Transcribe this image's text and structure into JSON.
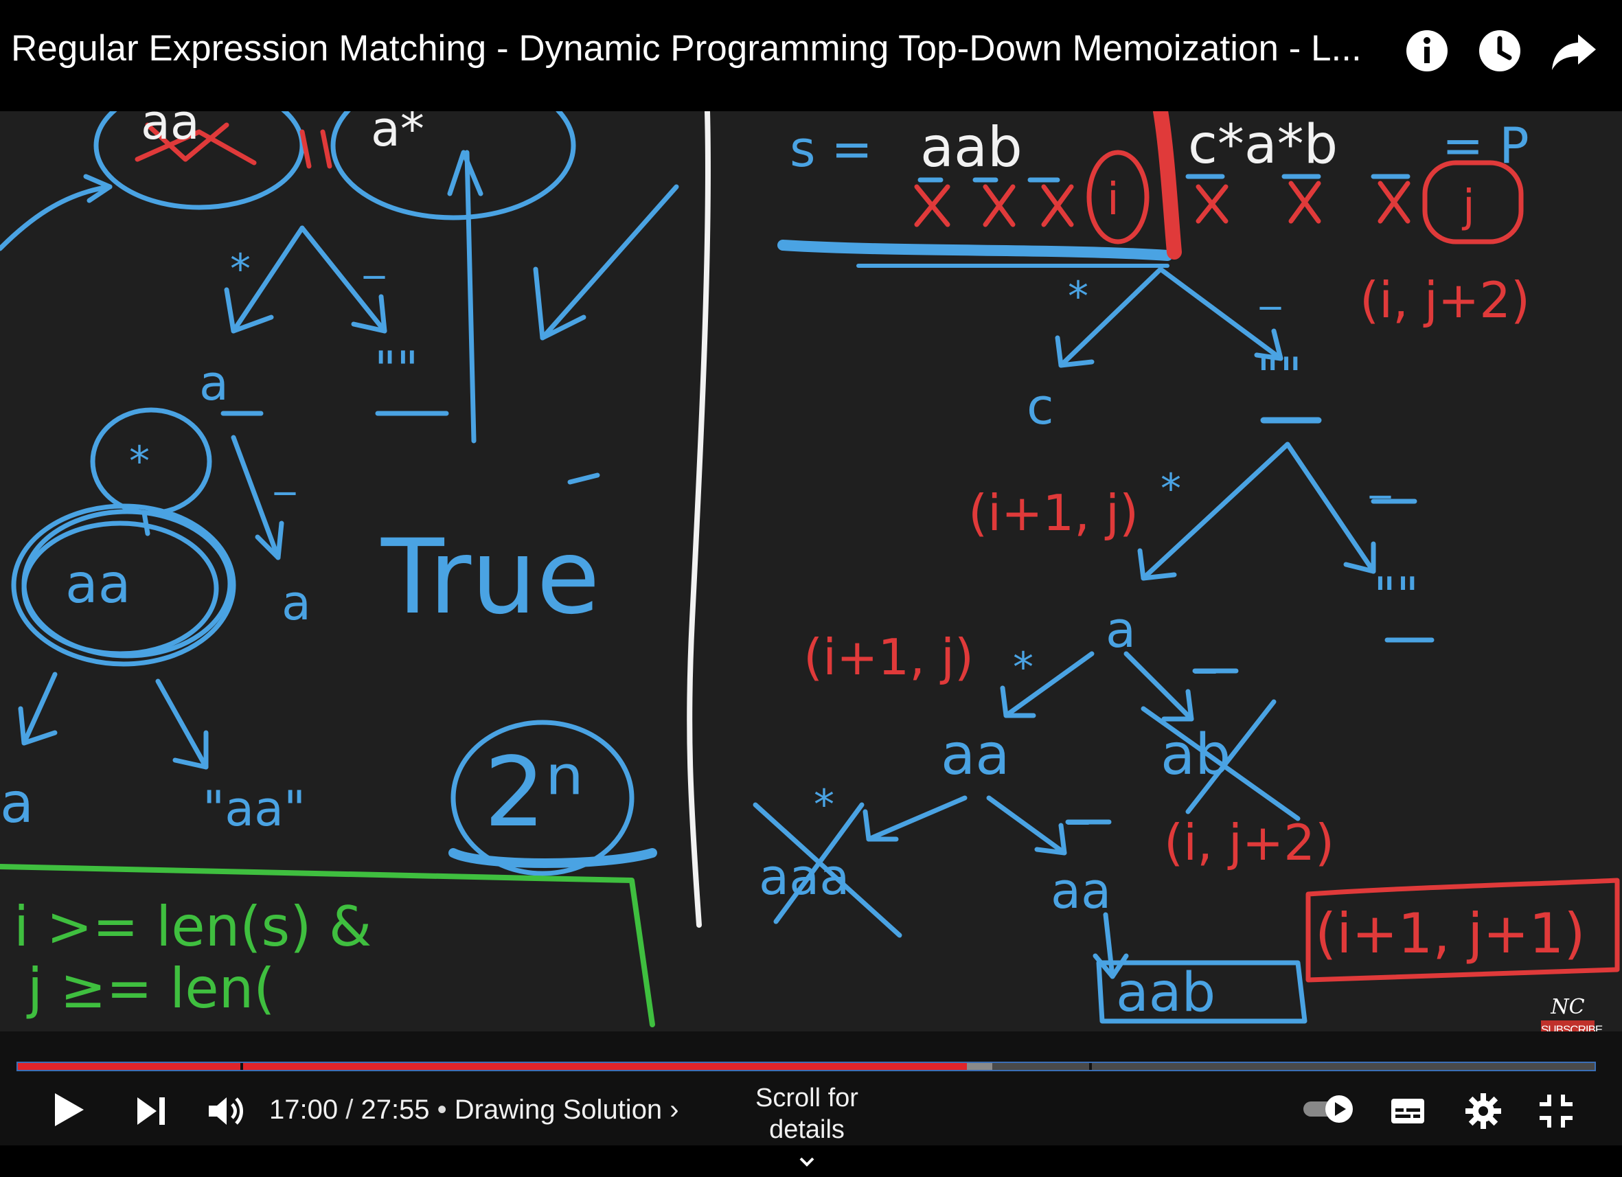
{
  "header": {
    "title": "Regular Expression Matching - Dynamic Programming Top-Down Memoization - L...",
    "icons": [
      "info-icon",
      "watch-later-icon",
      "share-icon"
    ]
  },
  "board": {
    "left": {
      "top_tokens": [
        "aa",
        "a*"
      ],
      "branch_star": "*",
      "branch_underscore": "_",
      "node_a": "a",
      "node_empty": "\"\"",
      "node_aa": "aa",
      "node_a2": "a",
      "node_a3": "a",
      "node_aa_quoted": "\"aa\"",
      "true_label": "True",
      "complexity": "2ⁿ",
      "base_case_line1": "i >= len(s) &",
      "base_case_line2": "j ≥= len(",
      "underscore2": "_"
    },
    "right": {
      "s_label": "s =",
      "s_string": "aab",
      "p_string": "c*a*b",
      "p_label": "= P",
      "pointer_i": "i",
      "pointer_j": "j",
      "star1": "*",
      "dash1": "_",
      "note_i_j2_top": "(i, j+2)",
      "node_c": "c",
      "node_empty1": "\"\"",
      "note_i1_j_a": "(i+1, j)",
      "star2": "*",
      "dash2": "_",
      "node_empty2": "\"\"",
      "node_a": "a",
      "note_i1_j_b": "(i+1, j)",
      "star3": "*",
      "dash3": "_",
      "node_aa1": "aa",
      "node_ab_crossed": "ab",
      "star4": "*",
      "dash4": "_",
      "node_aaa_crossed": "aaa",
      "node_aa2": "aa",
      "note_i_j2_bottom": "(i, j+2)",
      "note_i1_j1": "(i+1, j+1)",
      "node_aab": "aab"
    },
    "colors": {
      "blue": "#4aa3e3",
      "red": "#e03a3a",
      "green": "#3fbf3f",
      "white": "#f2f2f2"
    }
  },
  "watermark": {
    "mark": "NC",
    "label": "SUBSCRIBE"
  },
  "player": {
    "current_time": "17:00",
    "duration": "27:55",
    "chapter": "Drawing Solution",
    "scroll_hint": "Scroll for details",
    "progress_played_pct": 60.2,
    "progress_buffered_pct": 61.8,
    "icons": [
      "play-icon",
      "next-icon",
      "volume-icon",
      "autoplay-toggle",
      "captions-icon",
      "settings-icon",
      "exit-fullscreen-icon"
    ],
    "colors": {
      "played": "#e0242a",
      "track": "#4a4a4a",
      "buffer": "#8a8a8a"
    }
  }
}
